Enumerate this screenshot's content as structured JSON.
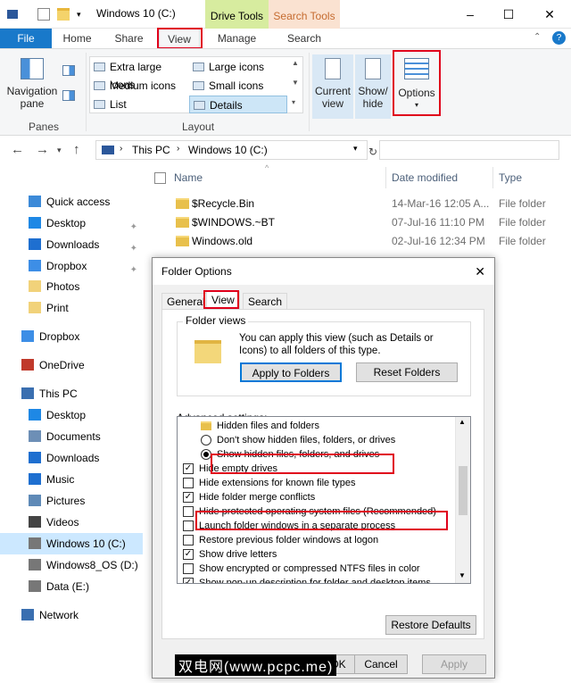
{
  "window": {
    "title": "Windows 10 (C:)"
  },
  "context_tabs": {
    "drive_tools": "Drive Tools",
    "search_tools": "Search Tools"
  },
  "ribbon_tabs": [
    "File",
    "Home",
    "Share",
    "View",
    "Manage",
    "Search"
  ],
  "ribbon": {
    "navigation_pane": "Navigation pane",
    "panes_label": "Panes",
    "layout_label": "Layout",
    "layout_items": [
      "Extra large icons",
      "Large icons",
      "Medium icons",
      "Small icons",
      "List",
      "Details"
    ],
    "current_view": "Current view",
    "show_hide": "Show/ hide",
    "options": "Options"
  },
  "address": {
    "crumbs": [
      "This PC",
      "Windows 10 (C:)"
    ]
  },
  "nav": {
    "items": [
      {
        "label": "Quick access",
        "icon": "star-icon"
      },
      {
        "label": "Desktop",
        "icon": "desktop-icon"
      },
      {
        "label": "Downloads",
        "icon": "download-icon"
      },
      {
        "label": "Dropbox",
        "icon": "dropbox-icon"
      },
      {
        "label": "Photos",
        "icon": "folder-icon"
      },
      {
        "label": "Print",
        "icon": "folder-icon"
      },
      {
        "label": "Dropbox",
        "icon": "dropbox-icon"
      },
      {
        "label": "OneDrive",
        "icon": "onedrive-icon"
      },
      {
        "label": "This PC",
        "icon": "pc-icon"
      },
      {
        "label": "Desktop",
        "icon": "desktop-icon"
      },
      {
        "label": "Documents",
        "icon": "documents-icon"
      },
      {
        "label": "Downloads",
        "icon": "download-icon"
      },
      {
        "label": "Music",
        "icon": "music-icon"
      },
      {
        "label": "Pictures",
        "icon": "pictures-icon"
      },
      {
        "label": "Videos",
        "icon": "videos-icon"
      },
      {
        "label": "Windows 10 (C:)",
        "icon": "drive-icon"
      },
      {
        "label": "Windows8_OS (D:)",
        "icon": "drive-icon"
      },
      {
        "label": "Data (E:)",
        "icon": "drive-icon"
      },
      {
        "label": "Network",
        "icon": "network-icon"
      }
    ]
  },
  "files": {
    "columns": [
      "Name",
      "Date modified",
      "Type"
    ],
    "rows": [
      {
        "name": "$Recycle.Bin",
        "date": "14-Mar-16 12:05 A...",
        "type": "File folder"
      },
      {
        "name": "$WINDOWS.~BT",
        "date": "07-Jul-16 11:10 PM",
        "type": "File folder"
      },
      {
        "name": "Windows.old",
        "date": "02-Jul-16 12:34 PM",
        "type": "File folder"
      }
    ]
  },
  "dialog": {
    "title": "Folder Options",
    "tabs": [
      "General",
      "View",
      "Search"
    ],
    "folder_views_label": "Folder views",
    "folder_views_text": "You can apply this view (such as Details or Icons) to all folders of this type.",
    "apply_btn": "Apply to Folders",
    "reset_btn": "Reset Folders",
    "advanced_label": "Advanced settings:",
    "advanced": [
      {
        "kind": "folder",
        "label": "Hidden files and folders"
      },
      {
        "kind": "radio",
        "checked": false,
        "label": "Don't show hidden files, folders, or drives"
      },
      {
        "kind": "radio",
        "checked": true,
        "label": "Show hidden files, folders, and drives"
      },
      {
        "kind": "check",
        "checked": true,
        "label": "Hide empty drives"
      },
      {
        "kind": "check",
        "checked": false,
        "label": "Hide extensions for known file types"
      },
      {
        "kind": "check",
        "checked": true,
        "label": "Hide folder merge conflicts"
      },
      {
        "kind": "check",
        "checked": false,
        "label": "Hide protected operating system files (Recommended)"
      },
      {
        "kind": "check",
        "checked": false,
        "label": "Launch folder windows in a separate process"
      },
      {
        "kind": "check",
        "checked": false,
        "label": "Restore previous folder windows at logon"
      },
      {
        "kind": "check",
        "checked": true,
        "label": "Show drive letters"
      },
      {
        "kind": "check",
        "checked": false,
        "label": "Show encrypted or compressed NTFS files in color"
      },
      {
        "kind": "check",
        "checked": true,
        "label": "Show pop-up description for folder and desktop items"
      }
    ],
    "restore_btn": "Restore Defaults",
    "ok_btn": "OK",
    "cancel_btn": "Cancel",
    "apply_footer_btn": "Apply"
  },
  "watermark": "双电网(www.pcpc.me)",
  "colors": {
    "accent": "#1979ca",
    "highlight_red": "#e0001b",
    "selected_nav": "#cce8ff"
  }
}
